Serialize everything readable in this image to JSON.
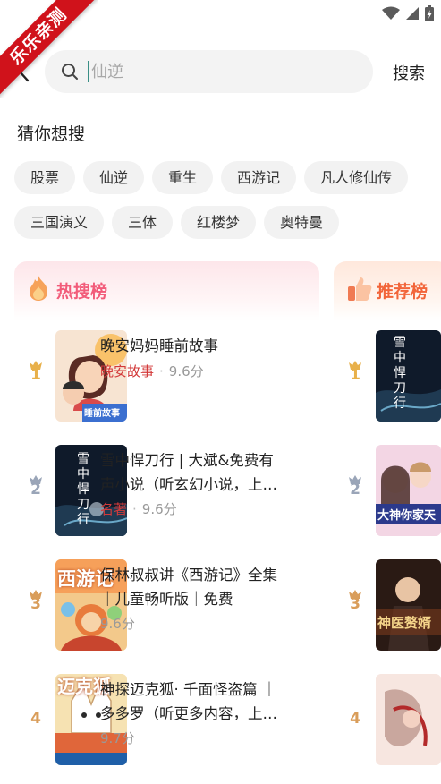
{
  "watermark": "乐乐亲测",
  "search": {
    "placeholder": "仙逆",
    "button_label": "搜索"
  },
  "guess": {
    "title": "猜你想搜",
    "rows": [
      [
        "股票",
        "仙逆",
        "重生",
        "西游记",
        "凡人修仙传"
      ],
      [
        "三国演义",
        "三体",
        "红楼梦",
        "奥特曼"
      ]
    ]
  },
  "hot_list": {
    "title": "热搜榜",
    "items": [
      {
        "rank": "1",
        "title": "晚安妈妈睡前故事",
        "tag": "晚安故事",
        "score": "9.6分",
        "cover_text": "睡前故事"
      },
      {
        "rank": "2",
        "title": "雪中悍刀行 | 大斌&免费有声小说（听玄幻小说，上…",
        "tag": "名著",
        "score": "9.6分",
        "cover_text": "雪中悍刀行"
      },
      {
        "rank": "3",
        "title": "保林叔叔讲《西游记》全集｜儿童畅听版｜免费",
        "tag": "",
        "score": "9.6分",
        "cover_text": "西游记"
      },
      {
        "rank": "4",
        "title": "神探迈克狐· 千面怪盗篇 ｜多多罗（听更多内容，上…",
        "tag": "",
        "score": "9.7分",
        "cover_text": "迈克狐"
      }
    ]
  },
  "rec_list": {
    "title": "推荐榜",
    "items": [
      {
        "rank": "1",
        "cover_text": "雪中悍刀行"
      },
      {
        "rank": "2",
        "cover_text": "大神你家天"
      },
      {
        "rank": "3",
        "cover_text": "神医赘婿"
      },
      {
        "rank": "4",
        "cover_text": ""
      }
    ]
  },
  "colors": {
    "hot_accent": "#f25c7a",
    "rec_accent": "#f2653a",
    "tag_red": "#d33a3a",
    "crown_gold": "#e8b04a",
    "crown_silver": "#9aa5b8",
    "crown_bronze": "#d99d5a",
    "ribbon": "#d0121b"
  }
}
